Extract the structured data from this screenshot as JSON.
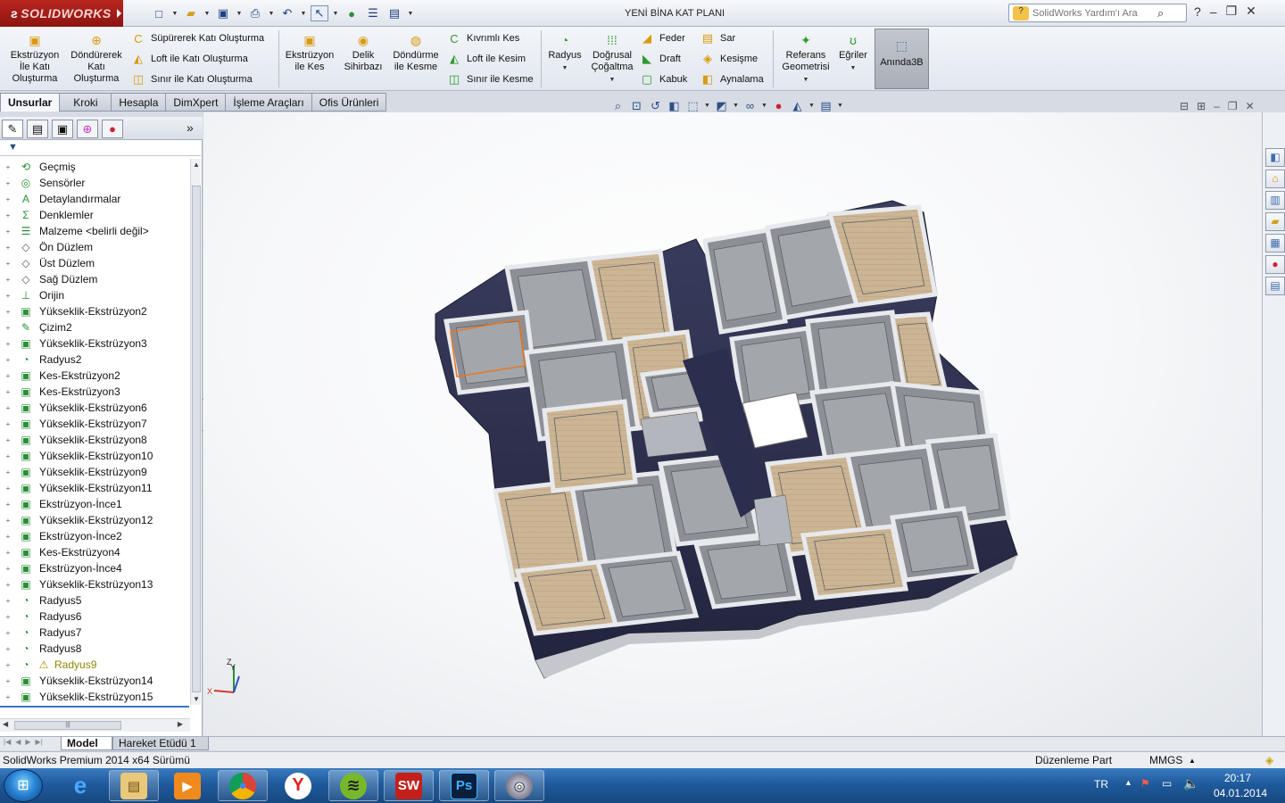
{
  "window": {
    "app_logo": "SOLIDWORKS",
    "document_title": "YENİ BİNA KAT PLANI",
    "help_search_placeholder": "SolidWorks Yardım'ı Ara"
  },
  "command_manager": {
    "extrude_boss": "Ekstrüzyon İle Katı Oluşturma",
    "revolve_boss": "Döndürerek Katı Oluşturma",
    "swept_boss": "Süpürerek Katı Oluşturma",
    "loft_boss": "Loft ile Katı Oluşturma",
    "boundary_boss": "Sınır ile Katı Oluşturma",
    "extrude_cut": "Ekstrüzyon ile Kes",
    "hole_wizard": "Delik Sihirbazı",
    "revolve_cut": "Döndürme ile Kesme",
    "swept_cut": "Kıvrımlı Kes",
    "loft_cut": "Loft ile Kesim",
    "boundary_cut": "Sınır ile Kesme",
    "fillet": "Radyus",
    "linear_pattern": "Doğrusal Çoğaltma",
    "rib": "Feder",
    "draft": "Draft",
    "shell": "Kabuk",
    "wrap": "Sar",
    "intersect": "Kesişme",
    "mirror": "Aynalama",
    "ref_geometry": "Referans Geometrisi",
    "curves": "Eğriler",
    "instant3d": "Anında3B"
  },
  "tabs": [
    "Unsurlar",
    "Kroki",
    "Hesapla",
    "DimXpert",
    "İşleme Araçları",
    "Ofis Ürünleri"
  ],
  "feature_tree": [
    {
      "label": "Geçmiş",
      "icon": "history-icon"
    },
    {
      "label": "Sensörler",
      "icon": "sensor-icon"
    },
    {
      "label": "Detaylandırmalar",
      "icon": "annotation-icon"
    },
    {
      "label": "Denklemler",
      "icon": "equation-icon"
    },
    {
      "label": "Malzeme <belirli değil>",
      "icon": "material-icon"
    },
    {
      "label": "Ön Düzlem",
      "icon": "plane-icon"
    },
    {
      "label": "Üst Düzlem",
      "icon": "plane-icon"
    },
    {
      "label": "Sağ Düzlem",
      "icon": "plane-icon"
    },
    {
      "label": "Orijin",
      "icon": "origin-icon"
    },
    {
      "label": "Yükseklik-Ekstrüzyon2",
      "icon": "extrude-icon"
    },
    {
      "label": "Çizim2",
      "icon": "sketch-icon"
    },
    {
      "label": "Yükseklik-Ekstrüzyon3",
      "icon": "extrude-icon"
    },
    {
      "label": "Radyus2",
      "icon": "fillet-icon"
    },
    {
      "label": "Kes-Ekstrüzyon2",
      "icon": "cut-extrude-icon"
    },
    {
      "label": "Kes-Ekstrüzyon3",
      "icon": "cut-extrude-icon"
    },
    {
      "label": "Yükseklik-Ekstrüzyon6",
      "icon": "extrude-icon"
    },
    {
      "label": "Yükseklik-Ekstrüzyon7",
      "icon": "extrude-icon"
    },
    {
      "label": "Yükseklik-Ekstrüzyon8",
      "icon": "extrude-icon"
    },
    {
      "label": "Yükseklik-Ekstrüzyon10",
      "icon": "extrude-icon"
    },
    {
      "label": "Yükseklik-Ekstrüzyon9",
      "icon": "extrude-icon"
    },
    {
      "label": "Yükseklik-Ekstrüzyon11",
      "icon": "extrude-icon"
    },
    {
      "label": "Ekstrüzyon-İnce1",
      "icon": "extrude-icon"
    },
    {
      "label": "Yükseklik-Ekstrüzyon12",
      "icon": "extrude-icon"
    },
    {
      "label": "Ekstrüzyon-İnce2",
      "icon": "extrude-icon"
    },
    {
      "label": "Kes-Ekstrüzyon4",
      "icon": "cut-extrude-icon"
    },
    {
      "label": "Ekstrüzyon-İnce4",
      "icon": "extrude-icon"
    },
    {
      "label": "Yükseklik-Ekstrüzyon13",
      "icon": "extrude-icon"
    },
    {
      "label": "Radyus5",
      "icon": "fillet-icon"
    },
    {
      "label": "Radyus6",
      "icon": "fillet-icon"
    },
    {
      "label": "Radyus7",
      "icon": "fillet-icon"
    },
    {
      "label": "Radyus8",
      "icon": "fillet-icon"
    },
    {
      "label": "Radyus9",
      "icon": "fillet-icon",
      "warning": true
    },
    {
      "label": "Yükseklik-Ekstrüzyon14",
      "icon": "extrude-icon"
    },
    {
      "label": "Yükseklik-Ekstrüzyon15",
      "icon": "extrude-icon"
    }
  ],
  "model_tabs": [
    "Model",
    "Hareket Etüdü 1"
  ],
  "status": {
    "version": "SolidWorks Premium 2014 x64 Sürümü",
    "mode": "Düzenleme Part",
    "units": "MMGS"
  },
  "taskbar": {
    "apps": [
      "windows-explorer",
      "internet-explorer",
      "file-explorer",
      "media-player",
      "chrome",
      "yandex",
      "spotify",
      "solidworks",
      "photoshop",
      "disc-utility"
    ],
    "language": "TR",
    "time": "20:17",
    "date": "04.01.2014"
  },
  "colors": {
    "slab": "#2e3150",
    "wall": "#8c8f95",
    "floor_wood": "#c9b394",
    "accent_blue": "#3a73c7",
    "solidworks_red": "#a51c18"
  }
}
